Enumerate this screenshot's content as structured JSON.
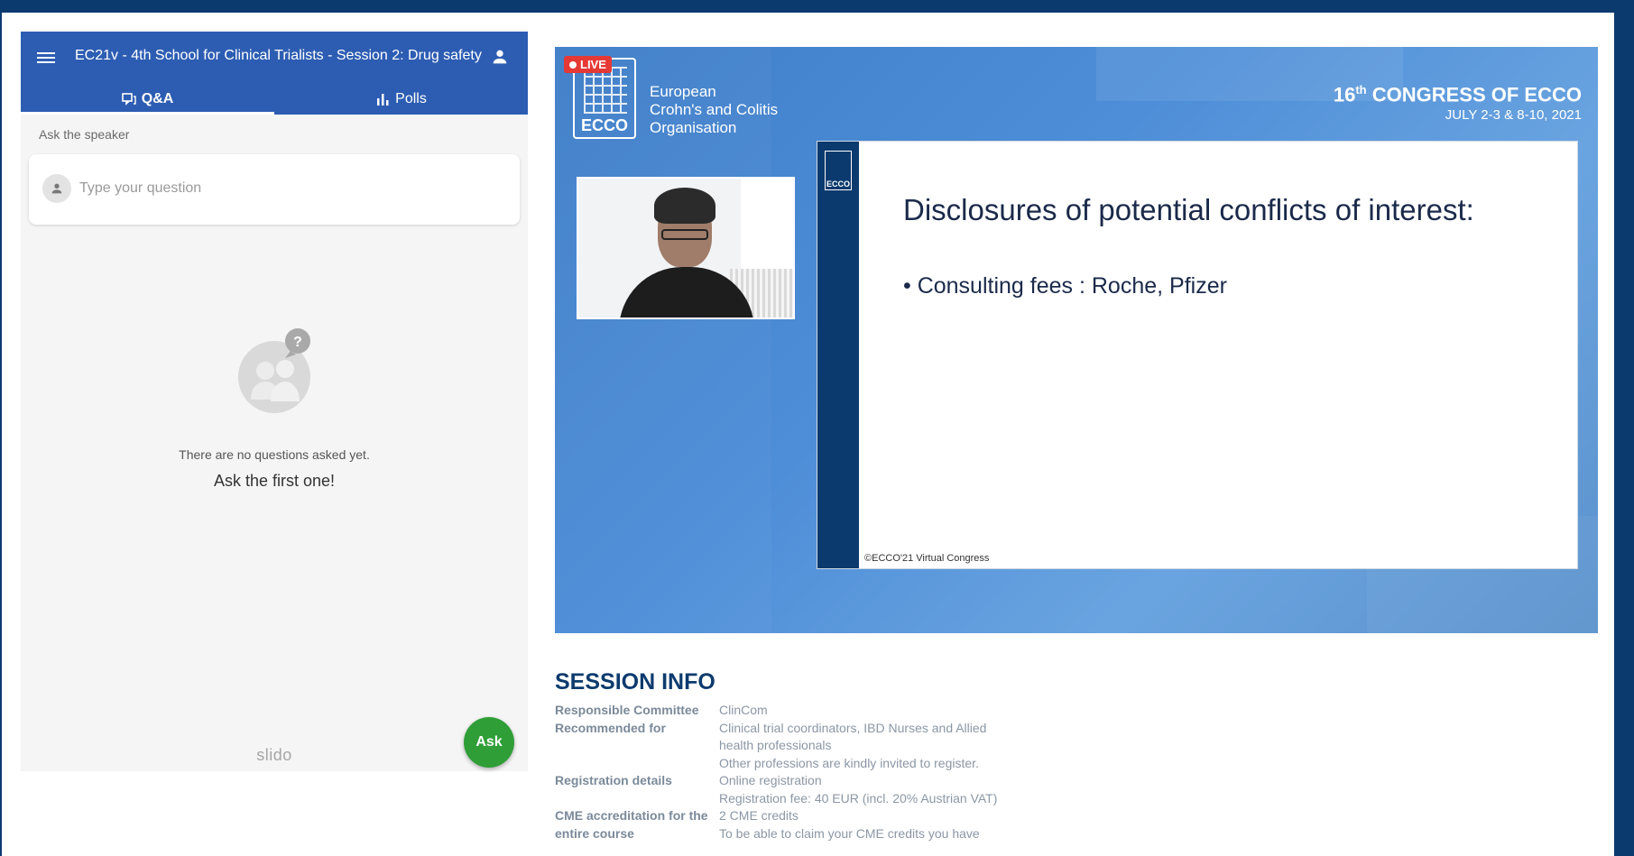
{
  "slido": {
    "title": "EC21v - 4th School for Clinical Trialists - Session 2: Drug safety",
    "tabs": [
      {
        "label": "Q&A",
        "icon": "chat-bubbles-icon",
        "active": true
      },
      {
        "label": "Polls",
        "icon": "bar-chart-icon",
        "active": false
      }
    ],
    "ask_label": "Ask the speaker",
    "question_placeholder": "Type your question",
    "empty_text": "There are no questions asked yet.",
    "empty_cta": "Ask the first one!",
    "brand": "slido",
    "ask_button": "Ask",
    "colors": {
      "header": "#2d5db3",
      "ask_button": "#2f9e37"
    }
  },
  "video": {
    "live_label": "LIVE",
    "logo_text": "ECCO",
    "org_name_lines": [
      "European",
      "Crohn's and Colitis",
      "Organisation"
    ],
    "congress_ordinal": "16",
    "congress_ordinal_suffix": "th",
    "congress_title": "CONGRESS OF ECCO",
    "congress_dates": "JULY 2-3 & 8-10, 2021",
    "slide": {
      "logo_text": "ECCO",
      "title": "Disclosures of potential conflicts of interest:",
      "bullet": "• Consulting fees : Roche, Pfizer",
      "footer": "©ECCO'21 Virtual Congress"
    }
  },
  "session_info": {
    "heading": "SESSION INFO",
    "rows": [
      {
        "label": "Responsible Committee",
        "values": [
          "ClinCom"
        ]
      },
      {
        "label": "Recommended for",
        "values": [
          "Clinical trial coordinators, IBD Nurses and Allied health professionals",
          "Other professions are kindly invited to register."
        ]
      },
      {
        "label": "Registration details",
        "values": [
          "Online registration",
          "Registration fee: 40 EUR (incl. 20% Austrian VAT)"
        ]
      },
      {
        "label": "CME accreditation for the entire course",
        "values": [
          "2 CME credits",
          "To be able to claim your CME credits you have"
        ]
      }
    ]
  }
}
